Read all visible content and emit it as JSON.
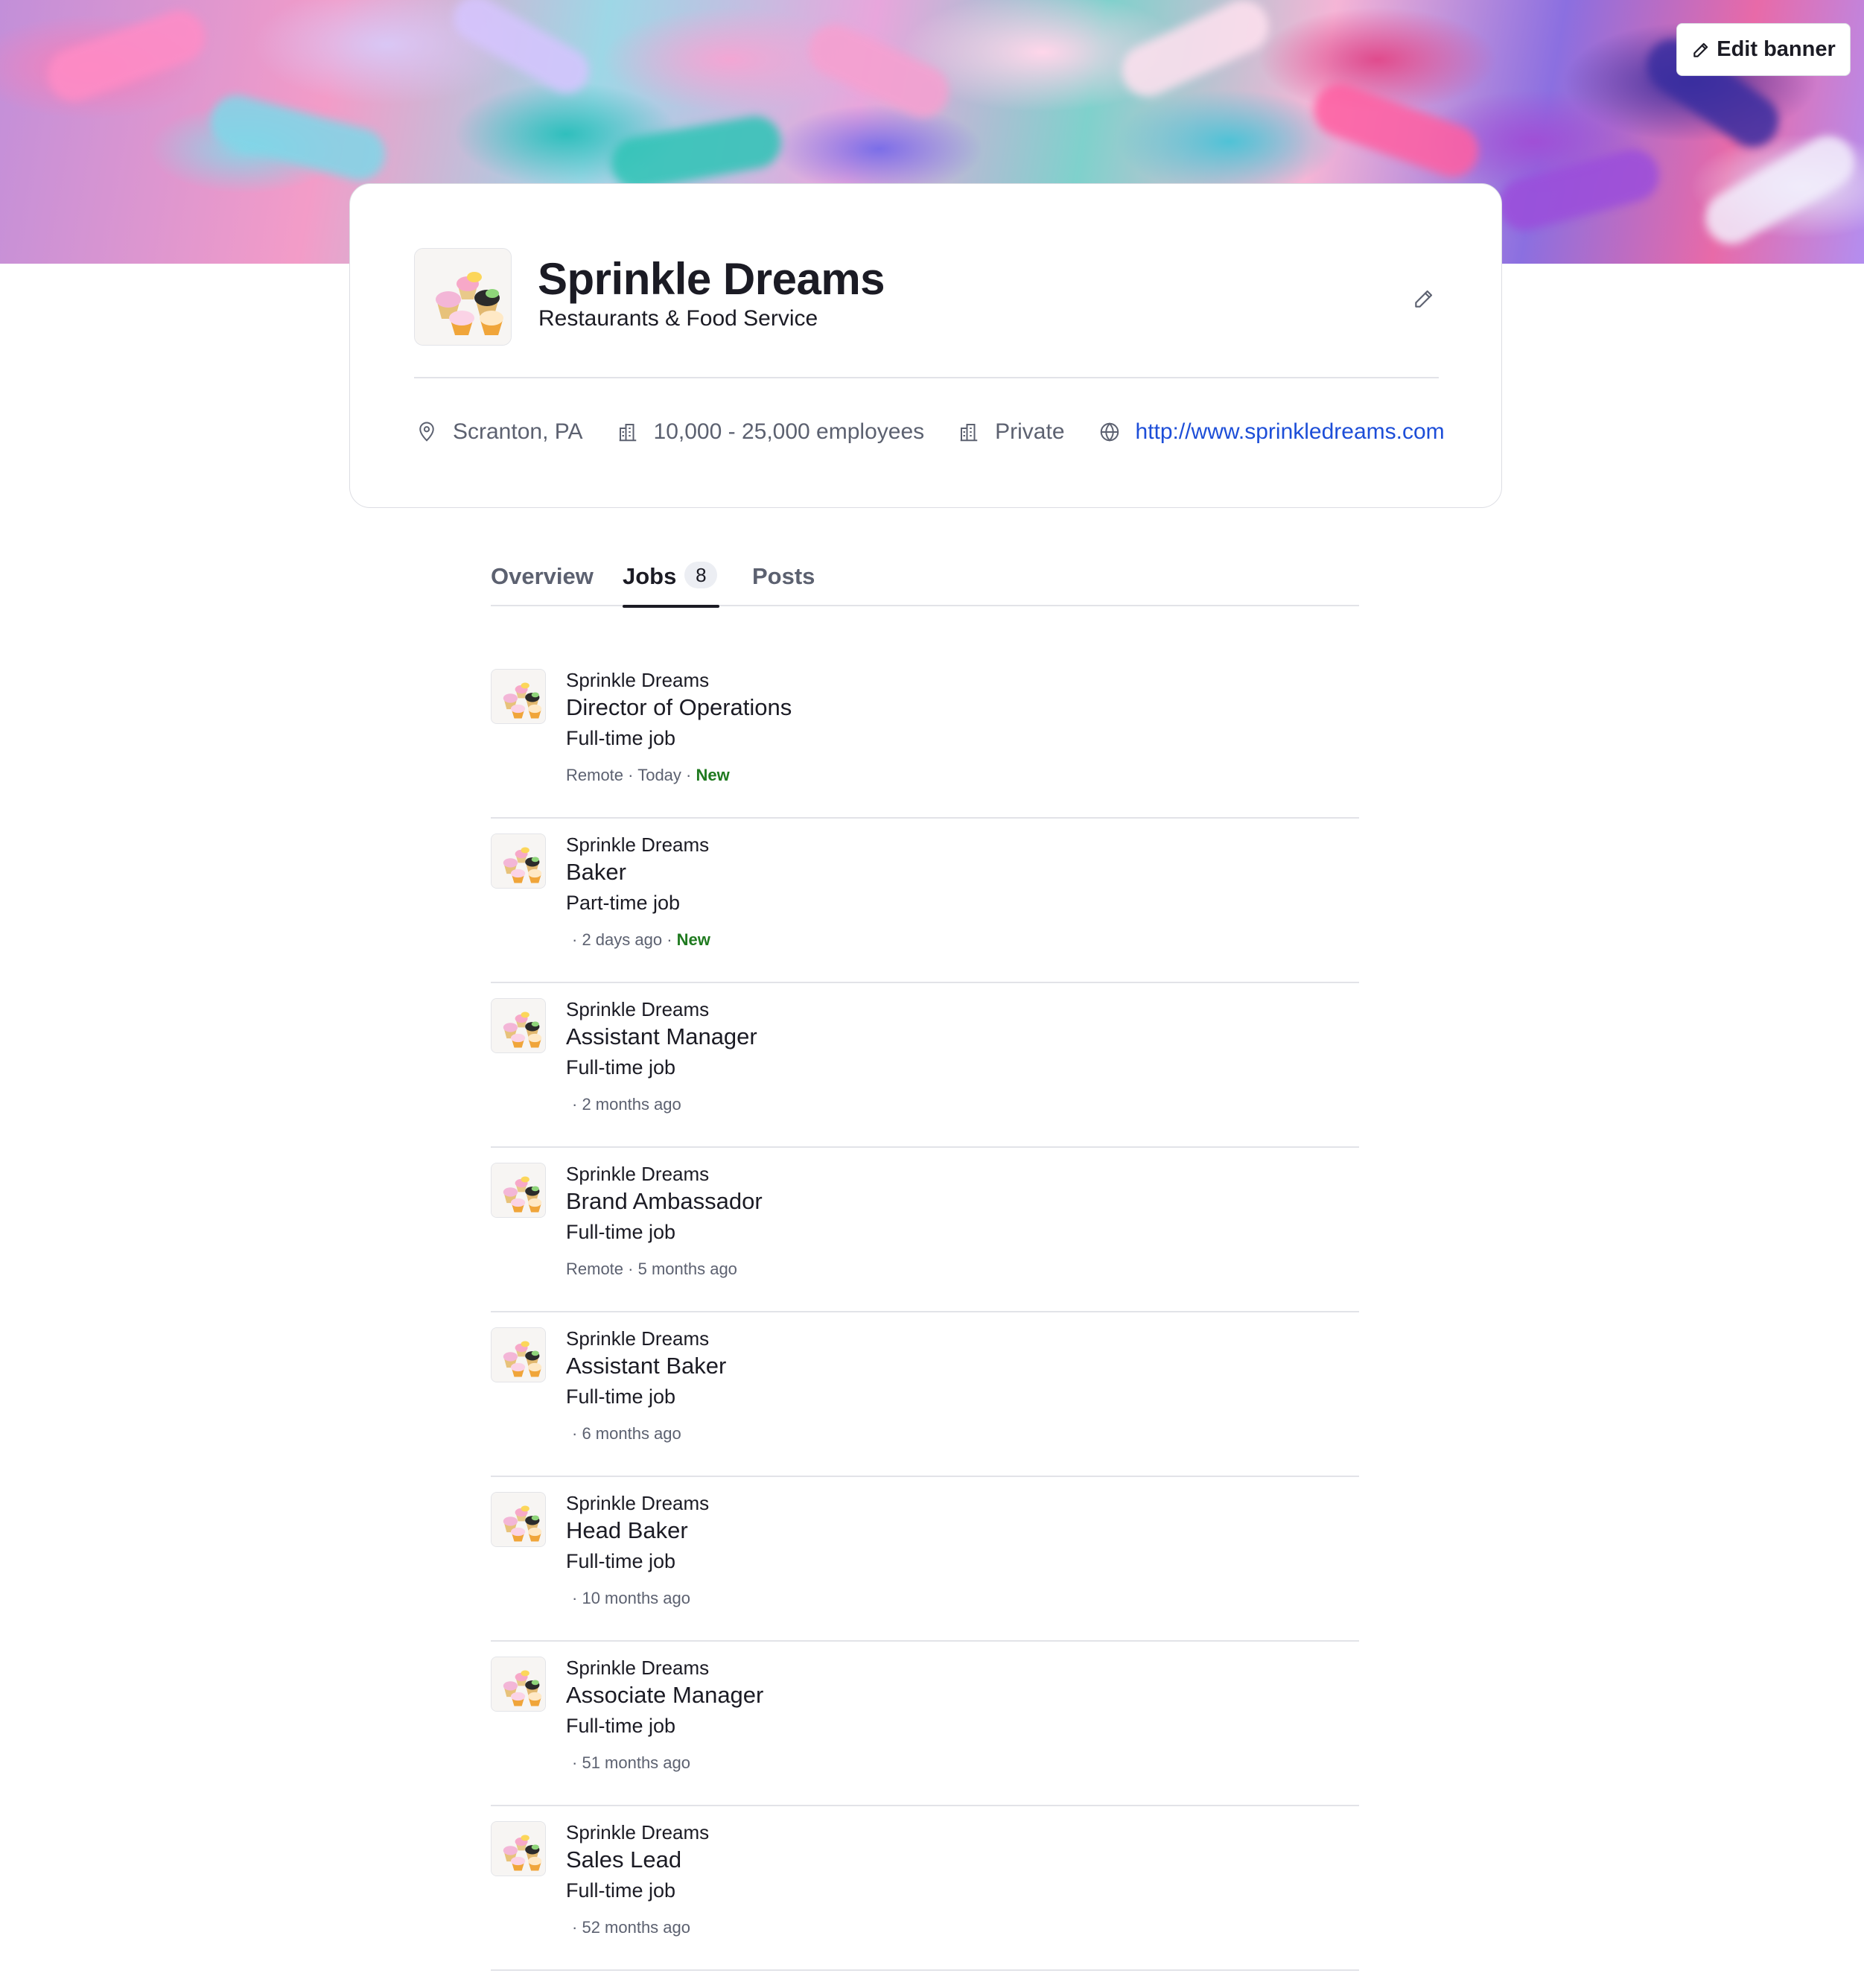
{
  "banner": {
    "edit_label": "Edit banner"
  },
  "company": {
    "name": "Sprinkle Dreams",
    "industry": "Restaurants & Food Service",
    "location": "Scranton, PA",
    "size": "10,000 - 25,000 employees",
    "ownership": "Private",
    "website": "http://www.sprinkledreams.com"
  },
  "tabs": {
    "overview": "Overview",
    "jobs": "Jobs",
    "jobs_count": "8",
    "posts": "Posts"
  },
  "jobs": [
    {
      "company": "Sprinkle Dreams",
      "title": "Director of Operations",
      "type": "Full-time job",
      "location": "Remote",
      "sep": " · ",
      "posted": "Today",
      "new": "New"
    },
    {
      "company": "Sprinkle Dreams",
      "title": "Baker",
      "type": "Part-time job",
      "location": "",
      "sep": "· ",
      "posted": "2 days ago",
      "new": "New"
    },
    {
      "company": "Sprinkle Dreams",
      "title": "Assistant Manager",
      "type": "Full-time job",
      "location": "",
      "sep": "· ",
      "posted": "2 months ago",
      "new": ""
    },
    {
      "company": "Sprinkle Dreams",
      "title": "Brand Ambassador",
      "type": "Full-time job",
      "location": "Remote",
      "sep": " · ",
      "posted": "5 months ago",
      "new": ""
    },
    {
      "company": "Sprinkle Dreams",
      "title": "Assistant Baker",
      "type": "Full-time job",
      "location": "",
      "sep": "· ",
      "posted": "6 months ago",
      "new": ""
    },
    {
      "company": "Sprinkle Dreams",
      "title": "Head Baker",
      "type": "Full-time job",
      "location": "",
      "sep": "· ",
      "posted": "10 months ago",
      "new": ""
    },
    {
      "company": "Sprinkle Dreams",
      "title": "Associate Manager",
      "type": "Full-time job",
      "location": "",
      "sep": "· ",
      "posted": "51 months ago",
      "new": ""
    },
    {
      "company": "Sprinkle Dreams",
      "title": "Sales Lead",
      "type": "Full-time job",
      "location": "",
      "sep": "· ",
      "posted": "52 months ago",
      "new": ""
    }
  ],
  "colors": {
    "link": "#1d4ed8",
    "new_badge": "#1f7a1f",
    "text": "#1b1b24",
    "muted": "#5c6170"
  }
}
